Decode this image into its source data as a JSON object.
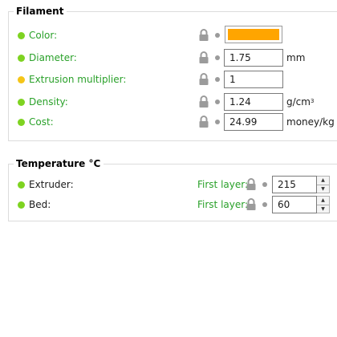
{
  "filament": {
    "title": "Filament",
    "rows": [
      {
        "label": "Color:",
        "status_color": "#7ed321",
        "swatch_color": "#ffa500"
      },
      {
        "label": "Diameter:",
        "status_color": "#7ed321",
        "value": "1.75",
        "unit": "mm"
      },
      {
        "label": "Extrusion multiplier:",
        "status_color": "#f5c518",
        "value": "1"
      },
      {
        "label": "Density:",
        "status_color": "#7ed321",
        "value": "1.24",
        "unit": "g/cm",
        "unit_sup": "3"
      },
      {
        "label": "Cost:",
        "status_color": "#7ed321",
        "value": "24.99",
        "unit": "money/kg"
      }
    ]
  },
  "temperature": {
    "title": "Temperature °C",
    "rows": [
      {
        "label": "Extruder:",
        "status_color": "#7ed321",
        "first_layer_label": "First layer:",
        "value": "215"
      },
      {
        "label": "Bed:",
        "status_color": "#7ed321",
        "first_layer_label": "First layer:",
        "value": "60"
      }
    ]
  },
  "icons": {
    "lock": "lock-icon",
    "reset_dot": "reset-dot-icon",
    "spin_up": "▲",
    "spin_down": "▼"
  },
  "colors": {
    "label_green": "#2aa12a",
    "lock_gray": "#9b9b9b"
  }
}
